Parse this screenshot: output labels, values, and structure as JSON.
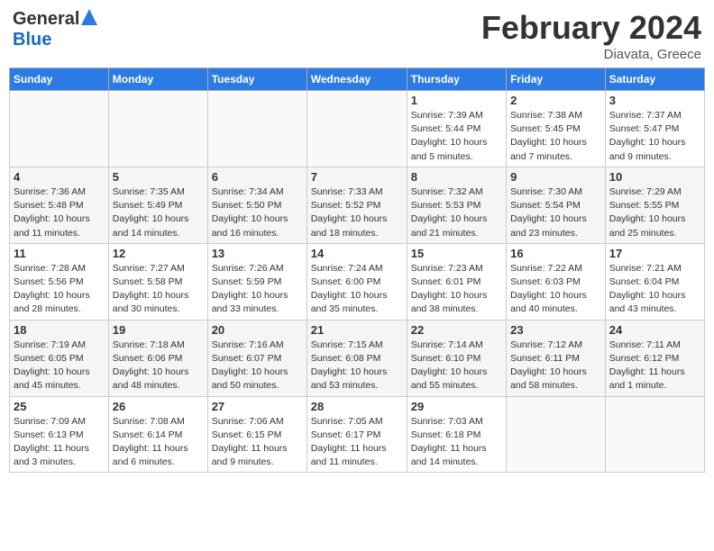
{
  "header": {
    "logo_general": "General",
    "logo_blue": "Blue",
    "month_year": "February 2024",
    "location": "Diavata, Greece"
  },
  "weekdays": [
    "Sunday",
    "Monday",
    "Tuesday",
    "Wednesday",
    "Thursday",
    "Friday",
    "Saturday"
  ],
  "weeks": [
    [
      {
        "num": "",
        "detail": ""
      },
      {
        "num": "",
        "detail": ""
      },
      {
        "num": "",
        "detail": ""
      },
      {
        "num": "",
        "detail": ""
      },
      {
        "num": "1",
        "detail": "Sunrise: 7:39 AM\nSunset: 5:44 PM\nDaylight: 10 hours\nand 5 minutes."
      },
      {
        "num": "2",
        "detail": "Sunrise: 7:38 AM\nSunset: 5:45 PM\nDaylight: 10 hours\nand 7 minutes."
      },
      {
        "num": "3",
        "detail": "Sunrise: 7:37 AM\nSunset: 5:47 PM\nDaylight: 10 hours\nand 9 minutes."
      }
    ],
    [
      {
        "num": "4",
        "detail": "Sunrise: 7:36 AM\nSunset: 5:48 PM\nDaylight: 10 hours\nand 11 minutes."
      },
      {
        "num": "5",
        "detail": "Sunrise: 7:35 AM\nSunset: 5:49 PM\nDaylight: 10 hours\nand 14 minutes."
      },
      {
        "num": "6",
        "detail": "Sunrise: 7:34 AM\nSunset: 5:50 PM\nDaylight: 10 hours\nand 16 minutes."
      },
      {
        "num": "7",
        "detail": "Sunrise: 7:33 AM\nSunset: 5:52 PM\nDaylight: 10 hours\nand 18 minutes."
      },
      {
        "num": "8",
        "detail": "Sunrise: 7:32 AM\nSunset: 5:53 PM\nDaylight: 10 hours\nand 21 minutes."
      },
      {
        "num": "9",
        "detail": "Sunrise: 7:30 AM\nSunset: 5:54 PM\nDaylight: 10 hours\nand 23 minutes."
      },
      {
        "num": "10",
        "detail": "Sunrise: 7:29 AM\nSunset: 5:55 PM\nDaylight: 10 hours\nand 25 minutes."
      }
    ],
    [
      {
        "num": "11",
        "detail": "Sunrise: 7:28 AM\nSunset: 5:56 PM\nDaylight: 10 hours\nand 28 minutes."
      },
      {
        "num": "12",
        "detail": "Sunrise: 7:27 AM\nSunset: 5:58 PM\nDaylight: 10 hours\nand 30 minutes."
      },
      {
        "num": "13",
        "detail": "Sunrise: 7:26 AM\nSunset: 5:59 PM\nDaylight: 10 hours\nand 33 minutes."
      },
      {
        "num": "14",
        "detail": "Sunrise: 7:24 AM\nSunset: 6:00 PM\nDaylight: 10 hours\nand 35 minutes."
      },
      {
        "num": "15",
        "detail": "Sunrise: 7:23 AM\nSunset: 6:01 PM\nDaylight: 10 hours\nand 38 minutes."
      },
      {
        "num": "16",
        "detail": "Sunrise: 7:22 AM\nSunset: 6:03 PM\nDaylight: 10 hours\nand 40 minutes."
      },
      {
        "num": "17",
        "detail": "Sunrise: 7:21 AM\nSunset: 6:04 PM\nDaylight: 10 hours\nand 43 minutes."
      }
    ],
    [
      {
        "num": "18",
        "detail": "Sunrise: 7:19 AM\nSunset: 6:05 PM\nDaylight: 10 hours\nand 45 minutes."
      },
      {
        "num": "19",
        "detail": "Sunrise: 7:18 AM\nSunset: 6:06 PM\nDaylight: 10 hours\nand 48 minutes."
      },
      {
        "num": "20",
        "detail": "Sunrise: 7:16 AM\nSunset: 6:07 PM\nDaylight: 10 hours\nand 50 minutes."
      },
      {
        "num": "21",
        "detail": "Sunrise: 7:15 AM\nSunset: 6:08 PM\nDaylight: 10 hours\nand 53 minutes."
      },
      {
        "num": "22",
        "detail": "Sunrise: 7:14 AM\nSunset: 6:10 PM\nDaylight: 10 hours\nand 55 minutes."
      },
      {
        "num": "23",
        "detail": "Sunrise: 7:12 AM\nSunset: 6:11 PM\nDaylight: 10 hours\nand 58 minutes."
      },
      {
        "num": "24",
        "detail": "Sunrise: 7:11 AM\nSunset: 6:12 PM\nDaylight: 11 hours\nand 1 minute."
      }
    ],
    [
      {
        "num": "25",
        "detail": "Sunrise: 7:09 AM\nSunset: 6:13 PM\nDaylight: 11 hours\nand 3 minutes."
      },
      {
        "num": "26",
        "detail": "Sunrise: 7:08 AM\nSunset: 6:14 PM\nDaylight: 11 hours\nand 6 minutes."
      },
      {
        "num": "27",
        "detail": "Sunrise: 7:06 AM\nSunset: 6:15 PM\nDaylight: 11 hours\nand 9 minutes."
      },
      {
        "num": "28",
        "detail": "Sunrise: 7:05 AM\nSunset: 6:17 PM\nDaylight: 11 hours\nand 11 minutes."
      },
      {
        "num": "29",
        "detail": "Sunrise: 7:03 AM\nSunset: 6:18 PM\nDaylight: 11 hours\nand 14 minutes."
      },
      {
        "num": "",
        "detail": ""
      },
      {
        "num": "",
        "detail": ""
      }
    ]
  ]
}
